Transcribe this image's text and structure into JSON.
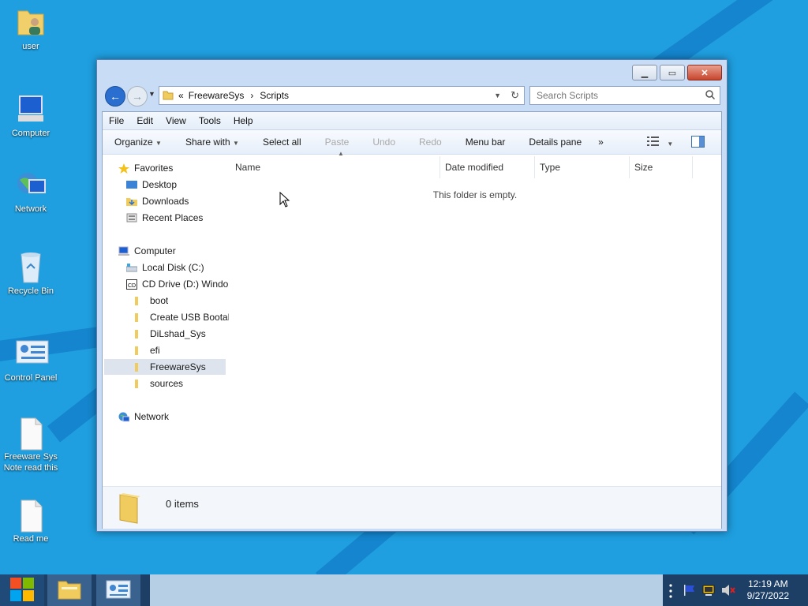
{
  "desktop": {
    "icons": [
      {
        "label": "user",
        "icon": "user-folder-icon"
      },
      {
        "label": "Computer",
        "icon": "computer-icon"
      },
      {
        "label": "Network",
        "icon": "network-icon"
      },
      {
        "label": "Recycle Bin",
        "icon": "recycle-bin-icon"
      },
      {
        "label": "Control Panel",
        "icon": "control-panel-icon"
      },
      {
        "label": "Freeware Sys\nNote read this",
        "icon": "text-file-icon"
      },
      {
        "label": "Read me",
        "icon": "text-file-icon"
      }
    ]
  },
  "window": {
    "address": {
      "chevrons": "«",
      "segment1": "FreewareSys",
      "separator": "›",
      "segment2": "Scripts"
    },
    "search_placeholder": "Search Scripts",
    "menu": [
      "File",
      "Edit",
      "View",
      "Tools",
      "Help"
    ],
    "commands": {
      "organize": "Organize",
      "share_with": "Share with",
      "select_all": "Select all",
      "paste": "Paste",
      "undo": "Undo",
      "redo": "Redo",
      "menu_bar": "Menu bar",
      "details_pane": "Details pane",
      "more": "»"
    },
    "nav": {
      "favorites": "Favorites",
      "desktop": "Desktop",
      "downloads": "Downloads",
      "recent_places": "Recent Places",
      "computer": "Computer",
      "local_disk": "Local Disk (C:)",
      "cd_drive": "CD Drive (D:) Windo",
      "boot": "boot",
      "create_usb": "Create USB Bootab",
      "dilshad": "DiLshad_Sys",
      "efi": "efi",
      "freewaresys": "FreewareSys",
      "sources": "sources",
      "network": "Network"
    },
    "columns": [
      "Name",
      "Date modified",
      "Type",
      "Size"
    ],
    "empty_message": "This folder is empty.",
    "item_count": "0 items"
  },
  "taskbar": {
    "clock_time": "12:19 AM",
    "clock_date": "9/27/2022"
  },
  "colors": {
    "desktop_bg": "#1f9fe0",
    "taskbar_bg": "#1d3f66",
    "window_frame": "#c9dcf5"
  }
}
